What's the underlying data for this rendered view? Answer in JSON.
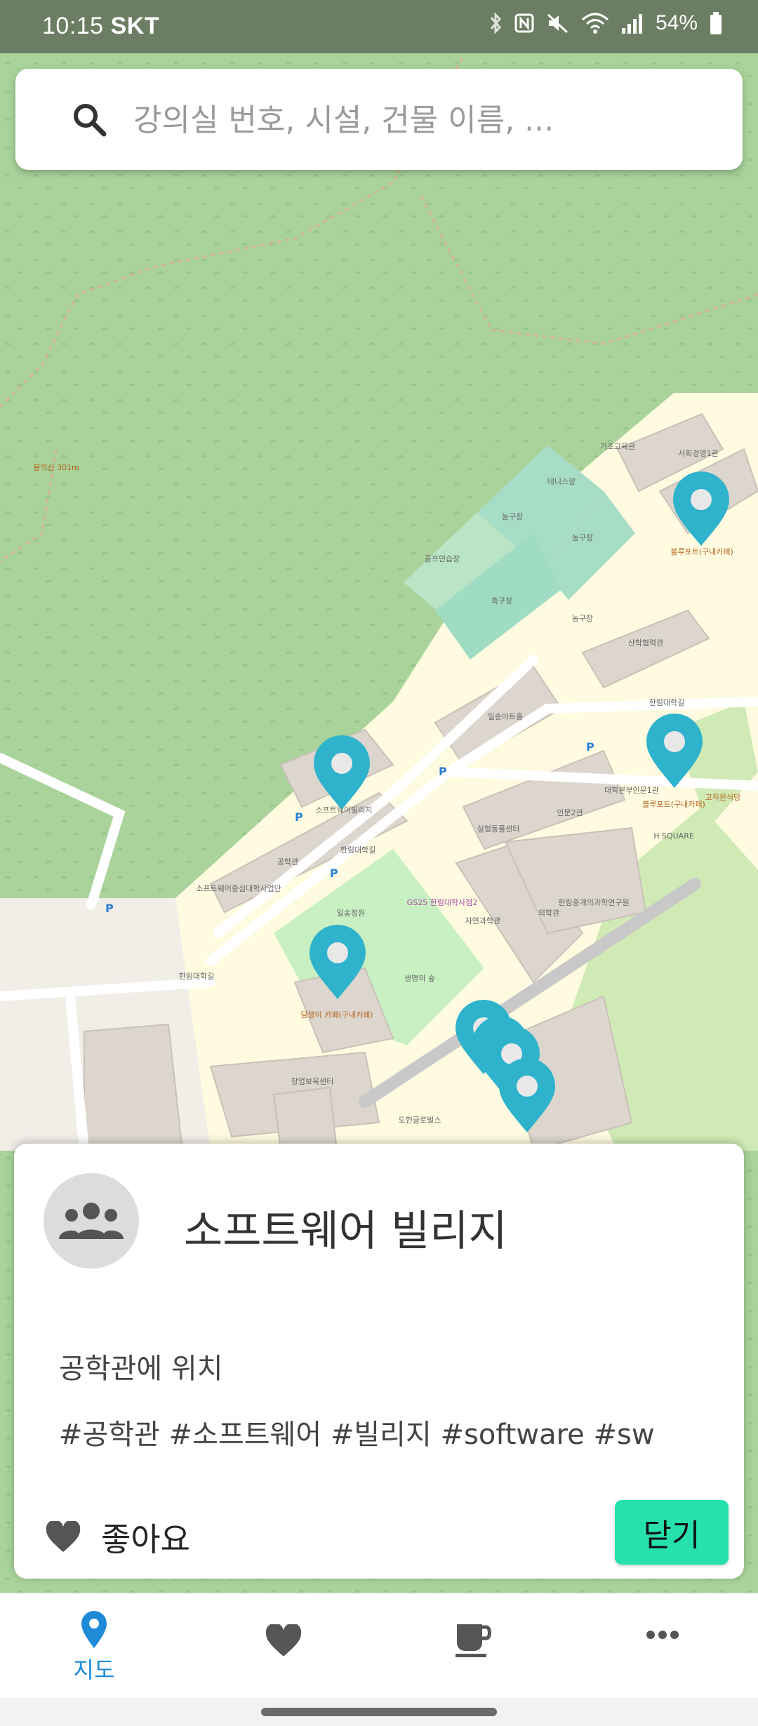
{
  "status_bar": {
    "time": "10:15",
    "carrier": "SKT",
    "battery": "54%"
  },
  "search": {
    "placeholder": "강의실 번호, 시설, 건물 이름, ..."
  },
  "map": {
    "labels": {
      "golf": "골프연습장",
      "tennis": "테니스장",
      "basketball": "농구장",
      "basketball2": "농구장",
      "football": "축구장",
      "basketball3": "농구장",
      "basic_hall": "기초교육관",
      "social_hall": "사회경영1관",
      "industry": "산학협력관",
      "ilsong_art": "일송아트홀",
      "hallym_road": "한림대학길",
      "hallym_road2": "한림대학길",
      "hallym_road3": "한림대학길",
      "engineering": "공학관",
      "sw_village": "소프트웨어빌리지",
      "sw_startup": "소프트웨어중심대학사업단",
      "ilsong_garden": "일송정원",
      "forest": "생명의 숲",
      "gs25": "GS25 한림대학사점2",
      "science": "자연과학관",
      "medicine": "의학관",
      "lab": "실험동물센터",
      "humanities": "인문2관",
      "main": "대학본부인문1관",
      "hallym_edu": "한림중개의과학연구원",
      "hsquare": "H SQUARE",
      "cafe1": "블루포트(구내카페)",
      "cafe2": "블루포트(구내카페)",
      "cafe3": "담쟁이 카페(구내카페)",
      "restaurant": "고직원식당",
      "health": "창업보육센터",
      "library": "도헌글로벌스",
      "bongui": "봉의산 301m",
      "parking": "P"
    }
  },
  "place": {
    "title": "소프트웨어 빌리지",
    "location": "공학관에 위치",
    "tags": "#공학관 #소프트웨어 #빌리지 #software #sw",
    "like_label": "좋아요",
    "close_label": "닫기"
  },
  "nav": {
    "map_label": "지도"
  },
  "colors": {
    "pin": "#2fb3cc",
    "accent": "#1e8bd6",
    "close_button": "#26e0ae"
  }
}
